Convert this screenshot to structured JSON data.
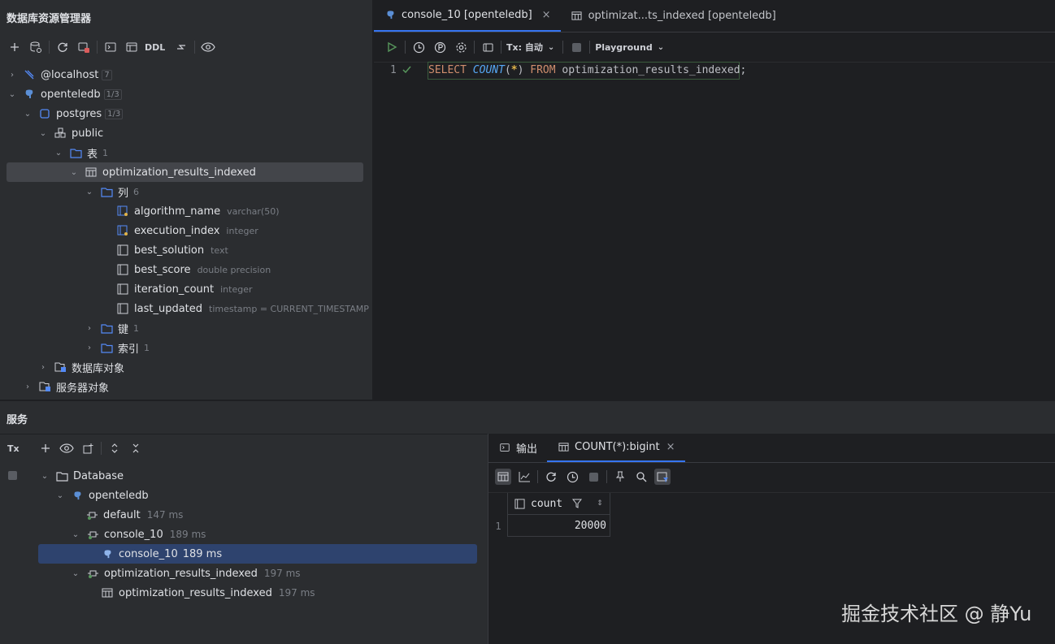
{
  "explorer": {
    "title": "数据库资源管理器",
    "toolbar": {
      "ddl": "DDL"
    },
    "tree": [
      {
        "label": "@localhost",
        "badge": "7"
      },
      {
        "label": "openteledb",
        "badge": "1/3"
      },
      {
        "label": "postgres",
        "badge": "1/3"
      },
      {
        "label": "public"
      },
      {
        "label": "表",
        "count": "1"
      },
      {
        "label": "optimization_results_indexed"
      },
      {
        "label": "列",
        "count": "6"
      },
      {
        "label": "algorithm_name",
        "type": "varchar(50)"
      },
      {
        "label": "execution_index",
        "type": "integer"
      },
      {
        "label": "best_solution",
        "type": "text"
      },
      {
        "label": "best_score",
        "type": "double precision"
      },
      {
        "label": "iteration_count",
        "type": "integer"
      },
      {
        "label": "last_updated",
        "type": "timestamp = CURRENT_TIMESTAMP"
      },
      {
        "label": "键",
        "count": "1"
      },
      {
        "label": "索引",
        "count": "1"
      },
      {
        "label": "数据库对象"
      },
      {
        "label": "服务器对象"
      }
    ]
  },
  "editor": {
    "tabs": [
      {
        "label": "console_10 [openteledb]",
        "close": "×"
      },
      {
        "label": "optimizat...ts_indexed [openteledb]"
      }
    ],
    "toolbar": {
      "tx": "Tx: 自动",
      "playground": "Playground"
    },
    "line_number": "1",
    "sql": {
      "select": "SELECT",
      "count": "COUNT",
      "open": "(",
      "star": "*",
      "close": ")",
      "from": "FROM",
      "table": "optimization_results_indexed",
      "semicolon": ";"
    }
  },
  "services": {
    "title": "服务",
    "tx_label": "Tx",
    "tree": [
      {
        "label": "Database"
      },
      {
        "label": "openteledb"
      },
      {
        "label": "default",
        "time": "147 ms"
      },
      {
        "label": "console_10",
        "time": "189 ms"
      },
      {
        "label": "console_10",
        "time": "189 ms"
      },
      {
        "label": "optimization_results_indexed",
        "time": "197 ms"
      },
      {
        "label": "optimization_results_indexed",
        "time": "197 ms"
      }
    ]
  },
  "results": {
    "tabs": [
      {
        "label": "输出"
      },
      {
        "label": "COUNT(*):bigint",
        "close": "×"
      }
    ],
    "columns": [
      {
        "label": "count"
      }
    ],
    "rows": [
      {
        "num": "1",
        "value": "20000"
      }
    ]
  },
  "watermark": "掘金技术社区 @ 静Yu"
}
